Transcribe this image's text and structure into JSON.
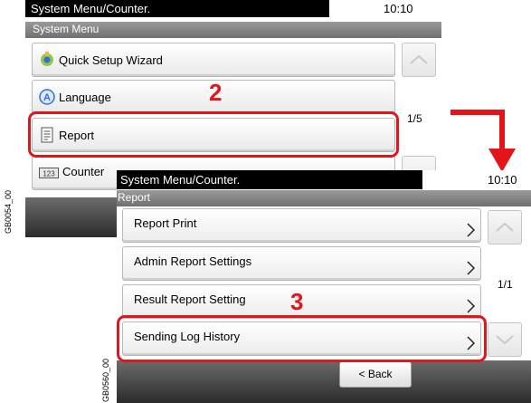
{
  "screen1": {
    "title": "System Menu/Counter.",
    "time": "10:10",
    "subheader": "System Menu",
    "items": [
      {
        "label": "Quick Setup Wizard",
        "icon": "wizard-icon"
      },
      {
        "label": "Language",
        "icon": "language-icon"
      },
      {
        "label": "Report",
        "icon": "report-icon"
      },
      {
        "label": "Counter",
        "icon": "counter-icon",
        "icon_text": "123"
      }
    ],
    "page_indicator": "1/5",
    "step": "2",
    "figure_code": "GB0054_00"
  },
  "screen2": {
    "title": "System Menu/Counter.",
    "time": "10:10",
    "subheader": "Report",
    "items": [
      {
        "label": "Report Print"
      },
      {
        "label": "Admin Report Settings"
      },
      {
        "label": "Result Report Setting"
      },
      {
        "label": "Sending Log History"
      }
    ],
    "page_indicator": "1/1",
    "back_label": "< Back",
    "step": "3",
    "figure_code": "GB0560_00"
  },
  "colors": {
    "highlight": "#e2151b",
    "header": "#000000",
    "accent_icon": "#2f6fd6"
  }
}
